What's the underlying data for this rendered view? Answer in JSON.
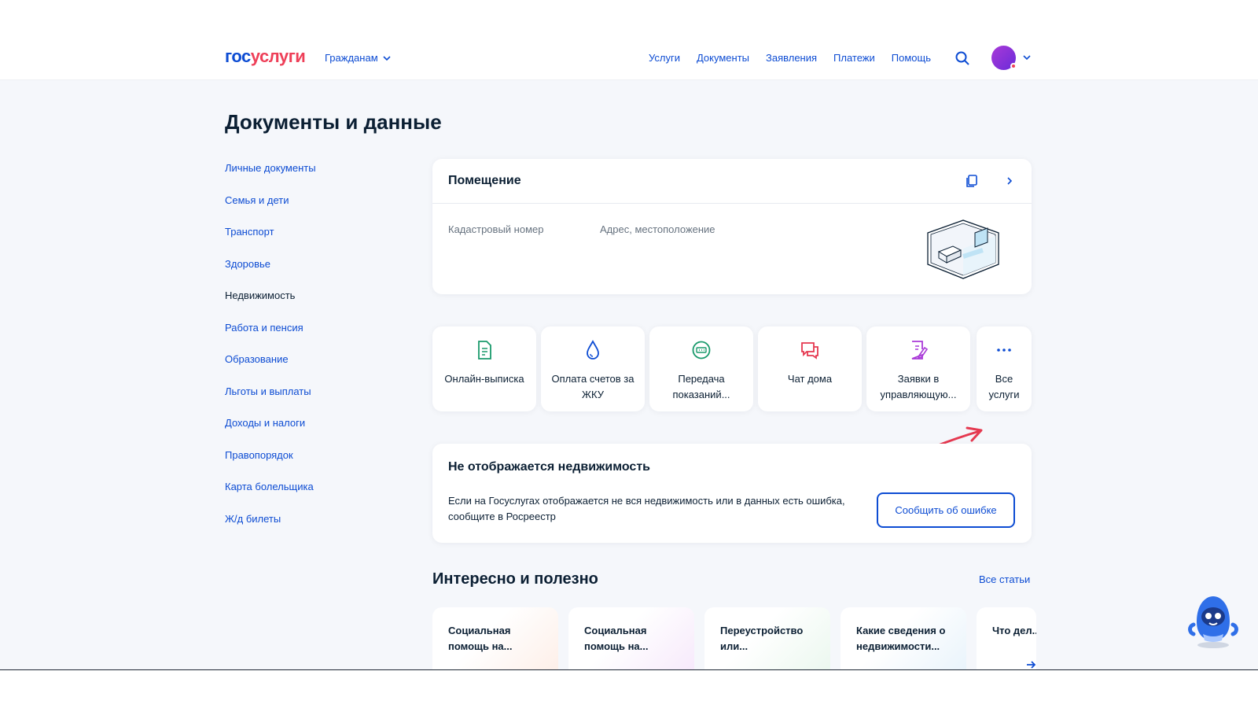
{
  "header": {
    "logo_part1": "гос",
    "logo_part2": "услуги",
    "citizens_label": "Гражданам",
    "nav": [
      "Услуги",
      "Документы",
      "Заявления",
      "Платежи",
      "Помощь"
    ]
  },
  "page_title": "Документы и данные",
  "sidebar": {
    "items": [
      {
        "label": "Личные документы"
      },
      {
        "label": "Семья и дети"
      },
      {
        "label": "Транспорт"
      },
      {
        "label": "Здоровье"
      },
      {
        "label": "Недвижимость",
        "active": true
      },
      {
        "label": "Работа и пенсия"
      },
      {
        "label": "Образование"
      },
      {
        "label": "Льготы и выплаты"
      },
      {
        "label": "Доходы и налоги"
      },
      {
        "label": "Правопорядок"
      },
      {
        "label": "Карта болельщика"
      },
      {
        "label": "Ж/д билеты"
      }
    ]
  },
  "property_card": {
    "title": "Помещение",
    "cadastral_label": "Кадастровый номер",
    "address_label": "Адрес, местоположение"
  },
  "services": [
    {
      "label": "Онлайн-выписка",
      "icon": "document-icon",
      "color": "#1a9a6c"
    },
    {
      "label": "Оплата счетов за ЖКУ",
      "icon": "water-drop-icon",
      "color": "#0d4cd3"
    },
    {
      "label": "Передача показаний...",
      "icon": "meter-icon",
      "color": "#1a9a6c"
    },
    {
      "label": "Чат дома",
      "icon": "chat-icon",
      "color": "#e53950"
    },
    {
      "label": "Заявки в управляющую...",
      "icon": "request-icon",
      "color": "#a93ad8"
    },
    {
      "label": "Все услуги",
      "icon": "more-icon",
      "color": "#0d4cd3"
    }
  ],
  "missing_card": {
    "title": "Не отображается недвижимость",
    "text": "Если на Госуслугах отображается не вся недвижимость или в данных есть ошибка, сообщите в Росреестр",
    "button": "Сообщить об ошибке"
  },
  "useful": {
    "title": "Интересно и полезно",
    "all_link": "Все статьи",
    "articles": [
      {
        "title": "Социальная помощь на..."
      },
      {
        "title": "Социальная помощь на..."
      },
      {
        "title": "Переустройство или..."
      },
      {
        "title": "Какие сведения о недвижимости..."
      },
      {
        "title": "Что дел... покупк..."
      }
    ]
  },
  "colors": {
    "accent": "#0d4cd3",
    "brand_red": "#ee3f58",
    "annotation_arrow": "#e53950"
  }
}
